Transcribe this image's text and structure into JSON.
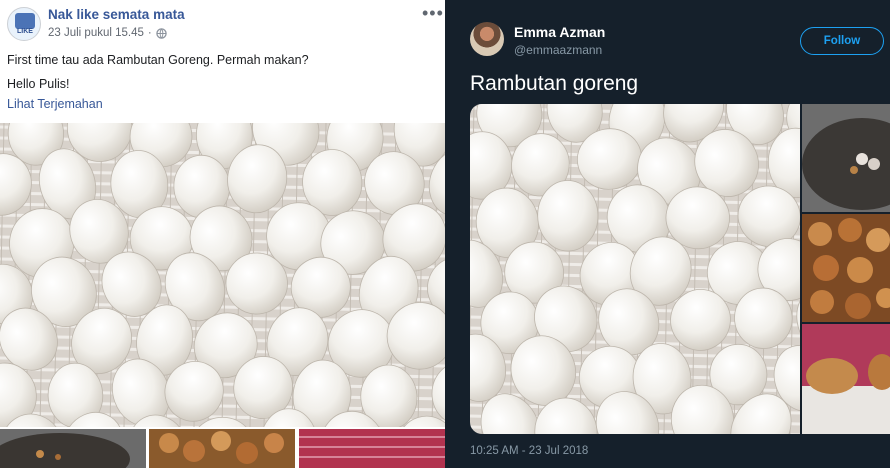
{
  "facebook_post": {
    "page_name": "Nak like semata mata",
    "avatar_text": "LIKE",
    "timestamp": "23 Juli pukul 15.45",
    "privacy_icon": "globe-icon",
    "more_icon": "more-options-icon",
    "more_glyph": "•••",
    "text_line_1": "First time tau ada Rambutan Goreng. Permah makan?",
    "text_line_2": "Hello Pulis!",
    "translate_link": "Lihat Terjemahan",
    "link_color": "#385898"
  },
  "tweet": {
    "display_name": "Emma Azman",
    "handle": "@emmaazmann",
    "follow_label": "Follow",
    "text": "Rambutan goreng",
    "timestamp": "10:25 AM - 23 Jul 2018",
    "background_color": "#15202b",
    "accent_color": "#1da1f2"
  }
}
